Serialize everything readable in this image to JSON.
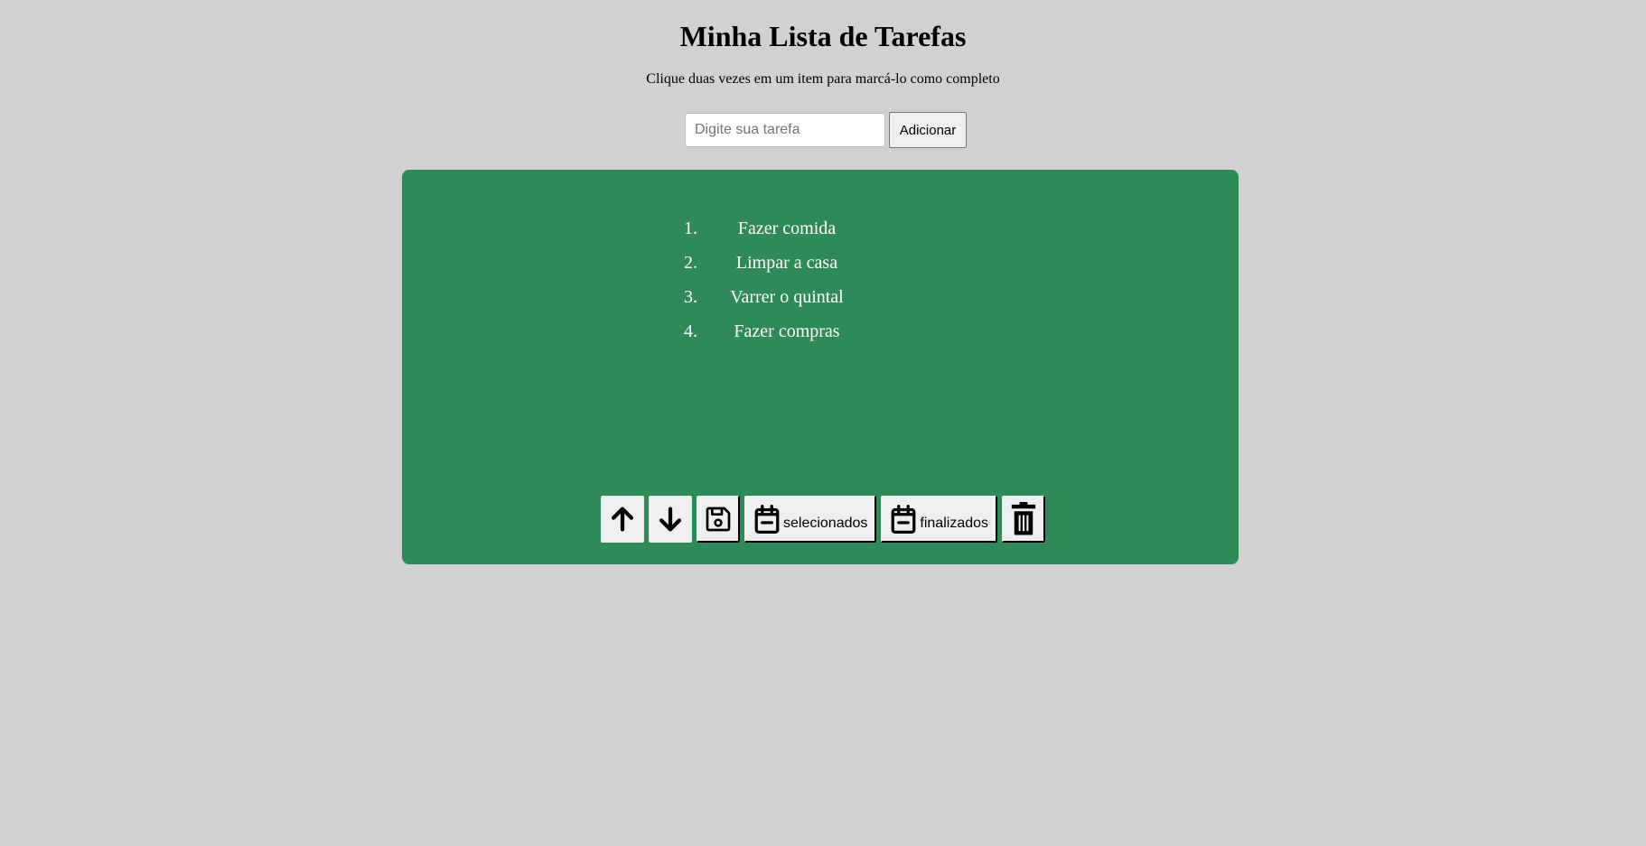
{
  "header": {
    "title": "Minha Lista de Tarefas",
    "subtitle": "Clique duas vezes em um item para marcá-lo como completo"
  },
  "form": {
    "placeholder": "Digite sua tarefa",
    "value": "",
    "add_label": "Adicionar"
  },
  "tasks": [
    {
      "number": "1.",
      "text": "Fazer comida"
    },
    {
      "number": "2.",
      "text": "Limpar a casa"
    },
    {
      "number": "3.",
      "text": "Varrer o quintal"
    },
    {
      "number": "4.",
      "text": "Fazer compras"
    }
  ],
  "toolbar": {
    "move_up_icon": "arrow-up-icon",
    "move_down_icon": "arrow-down-icon",
    "save_icon": "floppy-disk-icon",
    "remove_selected_label": "selecionados",
    "remove_selected_icon": "calendar-minus-icon",
    "remove_finished_label": "finalizados",
    "remove_finished_icon": "calendar-minus-icon",
    "clear_icon": "trash-icon"
  },
  "colors": {
    "background": "#d1d1d1",
    "panel": "#2e8b57",
    "task_text": "#ffffff"
  }
}
